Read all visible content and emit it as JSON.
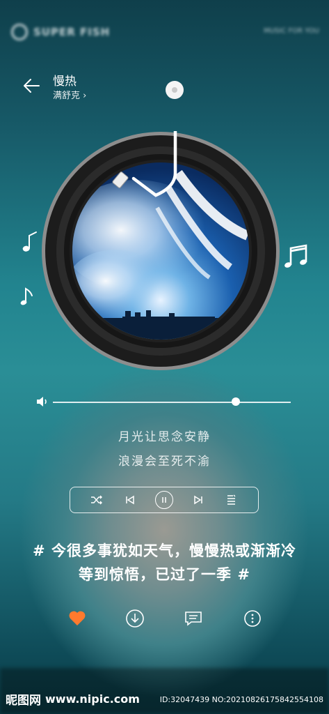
{
  "brand": {
    "name": "SUPER FISH",
    "right_text": "MUSIC FOR YOU"
  },
  "header": {
    "title": "慢热",
    "artist": "满舒克",
    "artist_chevron": "›"
  },
  "icons": {
    "back": "arrow-left-icon",
    "volume": "speaker-icon",
    "shuffle": "shuffle-icon",
    "prev": "skip-previous-icon",
    "play": "pause-icon",
    "next": "skip-next-icon",
    "playlist": "playlist-icon",
    "like": "heart-icon",
    "download": "download-icon",
    "comment": "comment-icon",
    "more": "more-icon"
  },
  "progress": {
    "position": 0.77
  },
  "lyrics": [
    "月光让思念安静",
    "浪漫会至死不渝"
  ],
  "slogan": {
    "line1": "# 今很多事犹如天气，慢慢热或渐渐冷",
    "line2": "等到惊悟，已过了一季 #"
  },
  "colors": {
    "accent": "#ff7a2e",
    "background_top": "#0f3f4b",
    "background_mid": "#2a8e96"
  },
  "watermark": {
    "logo": "昵图网",
    "url": "www.nipic.com",
    "id_text": "ID:32047439 NO:20210826175842554108"
  }
}
